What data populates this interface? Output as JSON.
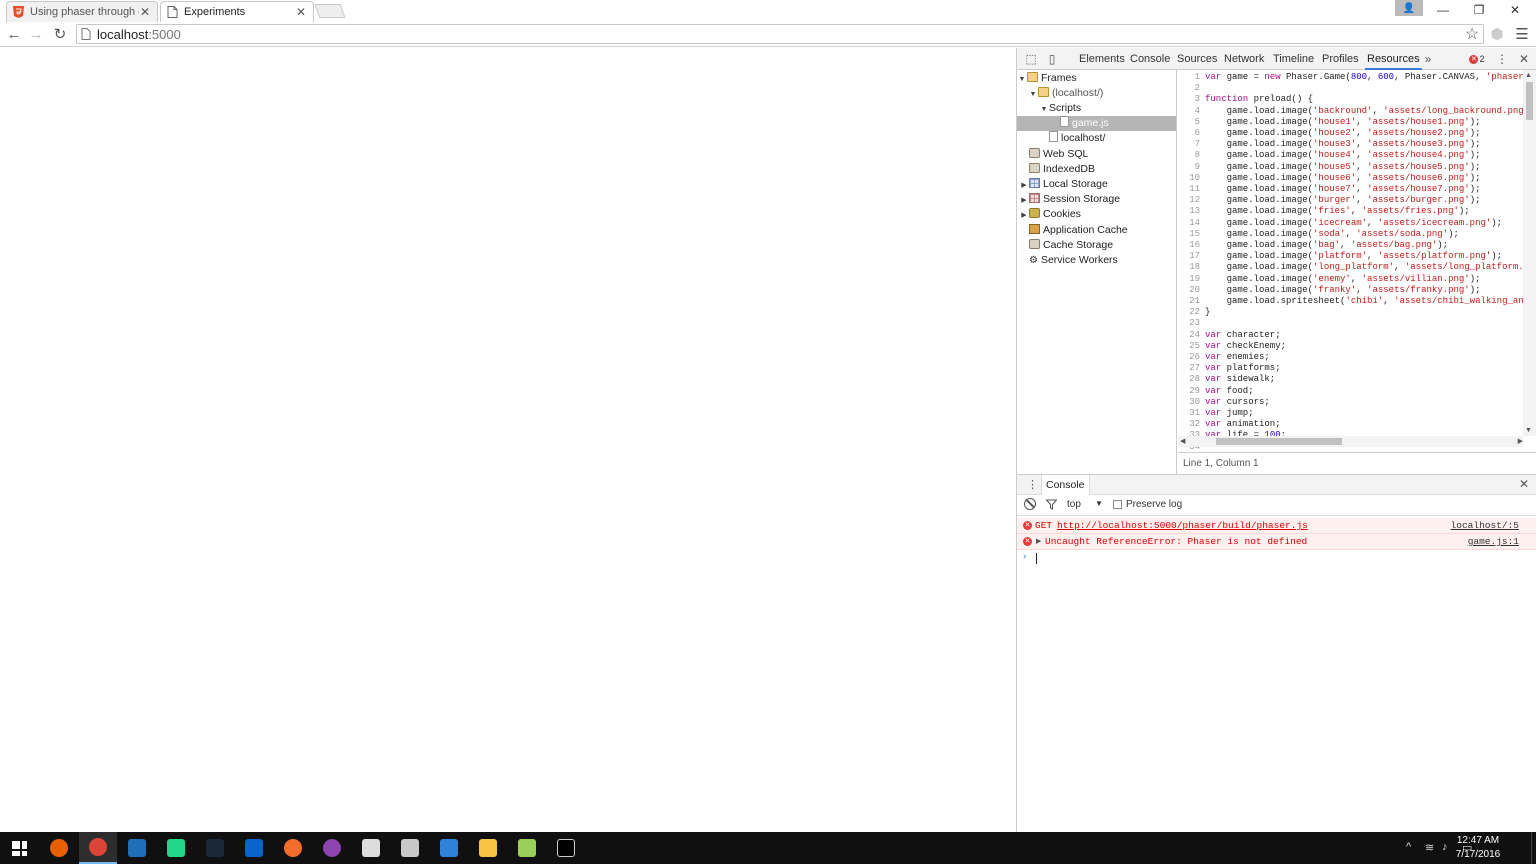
{
  "browser": {
    "tabs": [
      {
        "title": "Using phaser through git",
        "active": false
      },
      {
        "title": "Experiments",
        "active": true
      }
    ],
    "address": {
      "host": "localhost",
      "port": ":5000"
    }
  },
  "devtools": {
    "tabs": [
      "Elements",
      "Console",
      "Sources",
      "Network",
      "Timeline",
      "Profiles",
      "Resources"
    ],
    "active_tab": "Resources",
    "error_count": "2",
    "sidebar": [
      {
        "label": "Frames",
        "icon": "folder-icon"
      },
      {
        "label": "(localhost/)",
        "icon": "folder-icon"
      },
      {
        "label": "Scripts",
        "icon": "none"
      },
      {
        "label": "game.js",
        "icon": "document-icon"
      },
      {
        "label": "localhost/",
        "icon": "document-icon"
      },
      {
        "label": "Web SQL",
        "icon": "database-icon"
      },
      {
        "label": "IndexedDB",
        "icon": "database-icon"
      },
      {
        "label": "Local Storage",
        "icon": "storage-grid-icon"
      },
      {
        "label": "Session Storage",
        "icon": "storage-grid-icon"
      },
      {
        "label": "Cookies",
        "icon": "cookie-icon"
      },
      {
        "label": "Application Cache",
        "icon": "cache-icon"
      },
      {
        "label": "Cache Storage",
        "icon": "database-icon"
      },
      {
        "label": "Service Workers",
        "icon": "gear-icon"
      }
    ],
    "code_lines": [
      [
        [
          "kw",
          "var"
        ],
        [
          "t",
          " game = "
        ],
        [
          "kw",
          "new"
        ],
        [
          "t",
          " Phaser.Game("
        ],
        [
          "num",
          "800"
        ],
        [
          "t",
          ", "
        ],
        [
          "num",
          "600"
        ],
        [
          "t",
          ", Phaser.CANVAS, "
        ],
        [
          "str",
          "'phaser-"
        ]
      ],
      [],
      [
        [
          "kw",
          "function"
        ],
        [
          "t",
          " preload() {"
        ]
      ],
      [
        [
          "t",
          "    game.load.image("
        ],
        [
          "str",
          "'backround'"
        ],
        [
          "t",
          ", "
        ],
        [
          "str",
          "'assets/long_backround.png'"
        ]
      ],
      [
        [
          "t",
          "    game.load.image("
        ],
        [
          "str",
          "'house1'"
        ],
        [
          "t",
          ", "
        ],
        [
          "str",
          "'assets/house1.png'"
        ],
        [
          "t",
          ");"
        ]
      ],
      [
        [
          "t",
          "    game.load.image("
        ],
        [
          "str",
          "'house2'"
        ],
        [
          "t",
          ", "
        ],
        [
          "str",
          "'assets/house2.png'"
        ],
        [
          "t",
          ");"
        ]
      ],
      [
        [
          "t",
          "    game.load.image("
        ],
        [
          "str",
          "'house3'"
        ],
        [
          "t",
          ", "
        ],
        [
          "str",
          "'assets/house3.png'"
        ],
        [
          "t",
          ");"
        ]
      ],
      [
        [
          "t",
          "    game.load.image("
        ],
        [
          "str",
          "'house4'"
        ],
        [
          "t",
          ", "
        ],
        [
          "str",
          "'assets/house4.png'"
        ],
        [
          "t",
          ");"
        ]
      ],
      [
        [
          "t",
          "    game.load.image("
        ],
        [
          "str",
          "'house5'"
        ],
        [
          "t",
          ", "
        ],
        [
          "str",
          "'assets/house5.png'"
        ],
        [
          "t",
          ");"
        ]
      ],
      [
        [
          "t",
          "    game.load.image("
        ],
        [
          "str",
          "'house6'"
        ],
        [
          "t",
          ", "
        ],
        [
          "str",
          "'assets/house6.png'"
        ],
        [
          "t",
          ");"
        ]
      ],
      [
        [
          "t",
          "    game.load.image("
        ],
        [
          "str",
          "'house7'"
        ],
        [
          "t",
          ", "
        ],
        [
          "str",
          "'assets/house7.png'"
        ],
        [
          "t",
          ");"
        ]
      ],
      [
        [
          "t",
          "    game.load.image("
        ],
        [
          "str",
          "'burger'"
        ],
        [
          "t",
          ", "
        ],
        [
          "str",
          "'assets/burger.png'"
        ],
        [
          "t",
          ");"
        ]
      ],
      [
        [
          "t",
          "    game.load.image("
        ],
        [
          "str",
          "'fries'"
        ],
        [
          "t",
          ", "
        ],
        [
          "str",
          "'assets/fries.png'"
        ],
        [
          "t",
          ");"
        ]
      ],
      [
        [
          "t",
          "    game.load.image("
        ],
        [
          "str",
          "'icecream'"
        ],
        [
          "t",
          ", "
        ],
        [
          "str",
          "'assets/icecream.png'"
        ],
        [
          "t",
          ");"
        ]
      ],
      [
        [
          "t",
          "    game.load.image("
        ],
        [
          "str",
          "'soda'"
        ],
        [
          "t",
          ", "
        ],
        [
          "str",
          "'assets/soda.png'"
        ],
        [
          "t",
          ");"
        ]
      ],
      [
        [
          "t",
          "    game.load.image("
        ],
        [
          "str",
          "'bag'"
        ],
        [
          "t",
          ", "
        ],
        [
          "str",
          "'assets/bag.png'"
        ],
        [
          "t",
          ");"
        ]
      ],
      [
        [
          "t",
          "    game.load.image("
        ],
        [
          "str",
          "'platform'"
        ],
        [
          "t",
          ", "
        ],
        [
          "str",
          "'assets/platform.png'"
        ],
        [
          "t",
          ");"
        ]
      ],
      [
        [
          "t",
          "    game.load.image("
        ],
        [
          "str",
          "'long_platform'"
        ],
        [
          "t",
          ", "
        ],
        [
          "str",
          "'assets/long_platform.p"
        ]
      ],
      [
        [
          "t",
          "    game.load.image("
        ],
        [
          "str",
          "'enemy'"
        ],
        [
          "t",
          ", "
        ],
        [
          "str",
          "'assets/villian.png'"
        ],
        [
          "t",
          ");"
        ]
      ],
      [
        [
          "t",
          "    game.load.image("
        ],
        [
          "str",
          "'franky'"
        ],
        [
          "t",
          ", "
        ],
        [
          "str",
          "'assets/franky.png'"
        ],
        [
          "t",
          ");"
        ]
      ],
      [
        [
          "t",
          "    game.load.spritesheet("
        ],
        [
          "str",
          "'chibi'"
        ],
        [
          "t",
          ", "
        ],
        [
          "str",
          "'assets/chibi_walking_and"
        ]
      ],
      [
        [
          "t",
          "}"
        ]
      ],
      [],
      [
        [
          "kw",
          "var"
        ],
        [
          "t",
          " character;"
        ]
      ],
      [
        [
          "kw",
          "var"
        ],
        [
          "t",
          " checkEnemy;"
        ]
      ],
      [
        [
          "kw",
          "var"
        ],
        [
          "t",
          " enemies;"
        ]
      ],
      [
        [
          "kw",
          "var"
        ],
        [
          "t",
          " platforms;"
        ]
      ],
      [
        [
          "kw",
          "var"
        ],
        [
          "t",
          " sidewalk;"
        ]
      ],
      [
        [
          "kw",
          "var"
        ],
        [
          "t",
          " food;"
        ]
      ],
      [
        [
          "kw",
          "var"
        ],
        [
          "t",
          " cursors;"
        ]
      ],
      [
        [
          "kw",
          "var"
        ],
        [
          "t",
          " jump;"
        ]
      ],
      [
        [
          "kw",
          "var"
        ],
        [
          "t",
          " animation;"
        ]
      ],
      [
        [
          "kw",
          "var"
        ],
        [
          "t",
          " life = "
        ],
        [
          "num",
          "100"
        ],
        [
          "t",
          ";"
        ]
      ],
      []
    ],
    "status": "Line 1, Column 1",
    "console": {
      "tab_label": "Console",
      "context": "top",
      "preserve_log_label": "Preserve log",
      "messages": [
        {
          "prefix": "GET",
          "text": "http://localhost:5000/phaser/build/phaser.js",
          "source": "localhost/:5"
        },
        {
          "prefix": "",
          "text": "Uncaught ReferenceError: Phaser is not defined",
          "source": "game.js:1"
        }
      ]
    }
  },
  "taskbar": {
    "apps": [
      "windows-start-icon",
      "firefox-icon",
      "chrome-icon",
      "visual-studio-icon",
      "webstorm-icon",
      "steam-icon",
      "onedrive-icon",
      "origin-icon",
      "gog-icon",
      "unity-icon",
      "atlas-icon",
      "sourcetree-icon",
      "file-explorer-icon",
      "notepad-icon",
      "terminal-icon"
    ],
    "time": "12:47 AM",
    "date": "7/17/2016"
  }
}
